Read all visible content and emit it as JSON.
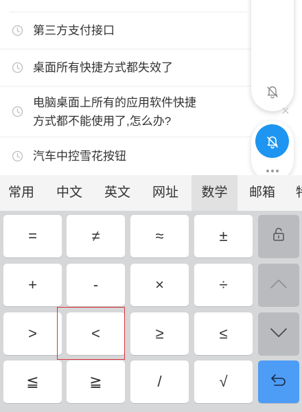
{
  "history": {
    "items": [
      {
        "label": "第三方支付接口"
      },
      {
        "label": "桌面所有快捷方式都失效了"
      },
      {
        "label": "电脑桌面上所有的应用软件快捷方式都不能使用了,怎么办?"
      },
      {
        "label": "汽车中控雪花按钮"
      }
    ]
  },
  "side_panel": {
    "icons": [
      "bell-muted-icon",
      "close-icon",
      "bell-muted-icon",
      "more-icon"
    ],
    "close_glyph": "×",
    "accent_color": "#1e95f0"
  },
  "tabs": [
    {
      "label": "常用"
    },
    {
      "label": "中文"
    },
    {
      "label": "英文"
    },
    {
      "label": "网址"
    },
    {
      "label": "数学",
      "active": true
    },
    {
      "label": "邮箱"
    },
    {
      "label": "特"
    }
  ],
  "keypad": {
    "rows": [
      [
        "=",
        "≠",
        "≈",
        "±"
      ],
      [
        "+",
        "-",
        "×",
        "÷"
      ],
      [
        ">",
        "<",
        "≥",
        "≤"
      ],
      [
        "≦",
        "≧",
        "/",
        "√"
      ]
    ],
    "side_keys": [
      "unlock-icon",
      "arrow-up-icon",
      "arrow-down-icon",
      "return-icon"
    ],
    "enter_color": "#4d9cf6",
    "highlight_color": "#d9333a"
  }
}
